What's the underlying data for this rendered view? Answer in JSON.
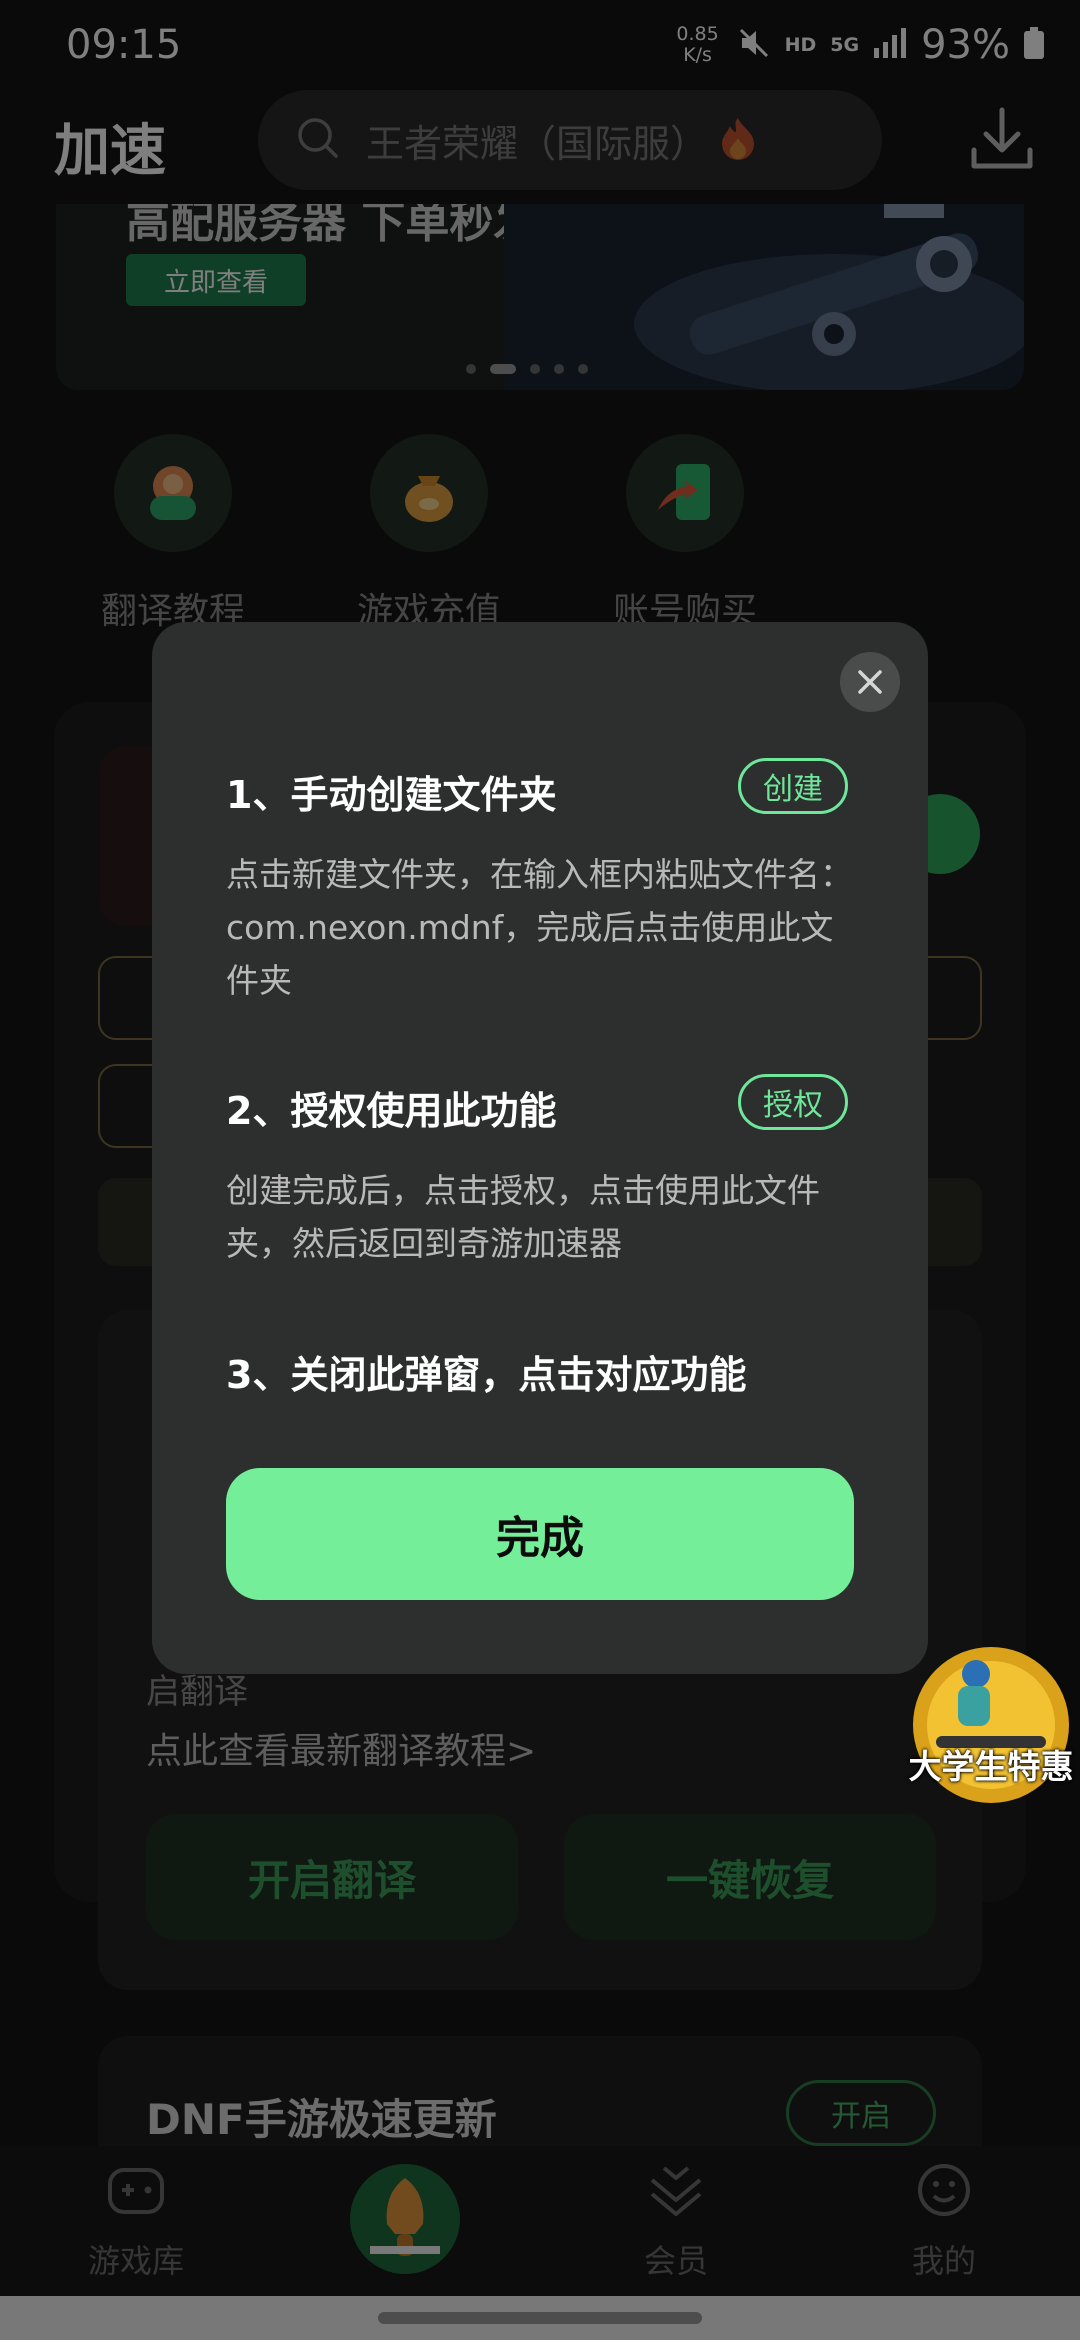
{
  "status_bar": {
    "time": "09:15",
    "net_speed_value": "0.85",
    "net_speed_unit": "K/s",
    "hd_label": "HD",
    "network_label": "5G",
    "battery_percent": "93%"
  },
  "header": {
    "title": "加速",
    "search_placeholder": "王者荣耀（国际服）"
  },
  "banner": {
    "title": "高配服务器 下单秒发货",
    "button_label": "立即查看",
    "page_count": 5,
    "active_page": 2
  },
  "shortcuts": [
    {
      "label": "翻译教程",
      "icon": "translate-tutorial-icon"
    },
    {
      "label": "游戏充值",
      "icon": "money-bag-icon"
    },
    {
      "label": "账号购买",
      "icon": "phone-account-icon"
    }
  ],
  "background": {
    "tutorial_line_partial": "启翻译",
    "tutorial_link": "点此查看最新翻译教程>",
    "open_translate_label": "开启翻译",
    "restore_label": "一键恢复",
    "dnf_title": "DNF手游极速更新",
    "dnf_toggle_label": "开启",
    "promo_label": "大学生特惠"
  },
  "bottom_nav": [
    {
      "label": "游戏库",
      "icon": "gamepad-icon"
    },
    {
      "label": "",
      "icon": "rocket-icon"
    },
    {
      "label": "会员",
      "icon": "diamond-icon"
    },
    {
      "label": "我的",
      "icon": "smile-icon"
    }
  ],
  "modal": {
    "step1_title": "1、手动创建文件夹",
    "step1_tag": "创建",
    "step1_desc": "点击新建文件夹，在输入框内粘贴文件名：com.nexon.mdnf，完成后点击使用此文件夹",
    "step2_title": "2、授权使用此功能",
    "step2_tag": "授权",
    "step2_desc": "创建完成后，点击授权，点击使用此文件夹，然后返回到奇游加速器",
    "step3_title": "3、关闭此弹窗，点击对应功能",
    "done_label": "完成"
  },
  "colors": {
    "accent": "#74ee98",
    "modal_bg": "#2d2f2e",
    "page_bg": "#141414"
  }
}
